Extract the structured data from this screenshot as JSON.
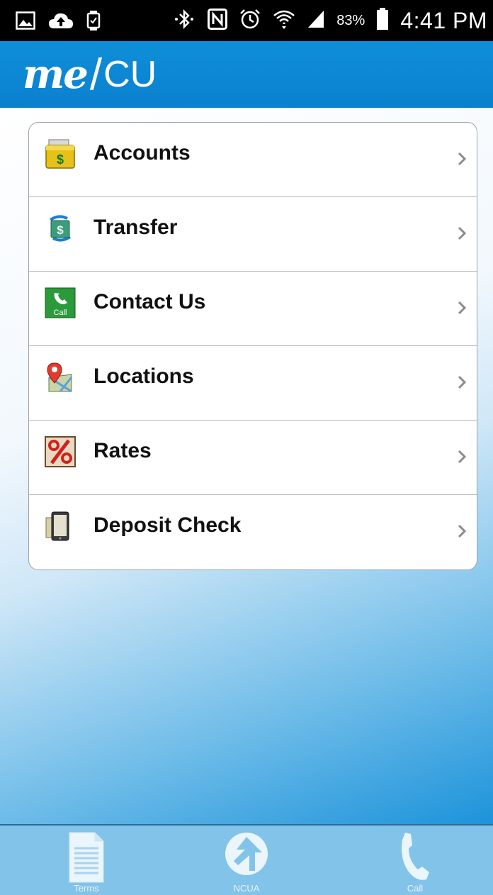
{
  "status_bar": {
    "left_icons": [
      "image-icon",
      "cloud-upload-icon",
      "watch-icon"
    ],
    "right_icons": [
      "bluetooth-icon",
      "nfc-icon",
      "alarm-icon",
      "wifi-icon",
      "signal-icon",
      "battery-icon"
    ],
    "battery_percent": "83%",
    "time": "4:41 PM"
  },
  "header": {
    "logo_me": "me",
    "logo_slash": "/",
    "logo_cu": "CU"
  },
  "menu": {
    "items": [
      {
        "label": "Accounts",
        "icon": "accounts-dollar-icon"
      },
      {
        "label": "Transfer",
        "icon": "transfer-icon"
      },
      {
        "label": "Contact Us",
        "icon": "call-icon"
      },
      {
        "label": "Locations",
        "icon": "map-pin-icon"
      },
      {
        "label": "Rates",
        "icon": "percent-icon"
      },
      {
        "label": "Deposit Check",
        "icon": "phone-check-icon"
      }
    ]
  },
  "tab_bar": {
    "tabs": [
      {
        "label": "Terms",
        "icon": "document-icon"
      },
      {
        "label": "NCUA",
        "icon": "ncua-logo-icon"
      },
      {
        "label": "Call",
        "icon": "phone-icon"
      }
    ]
  },
  "colors": {
    "header_blue": "#0f8fd8",
    "tab_bar_blue": "#82c3e9",
    "status_bar": "#000000"
  }
}
